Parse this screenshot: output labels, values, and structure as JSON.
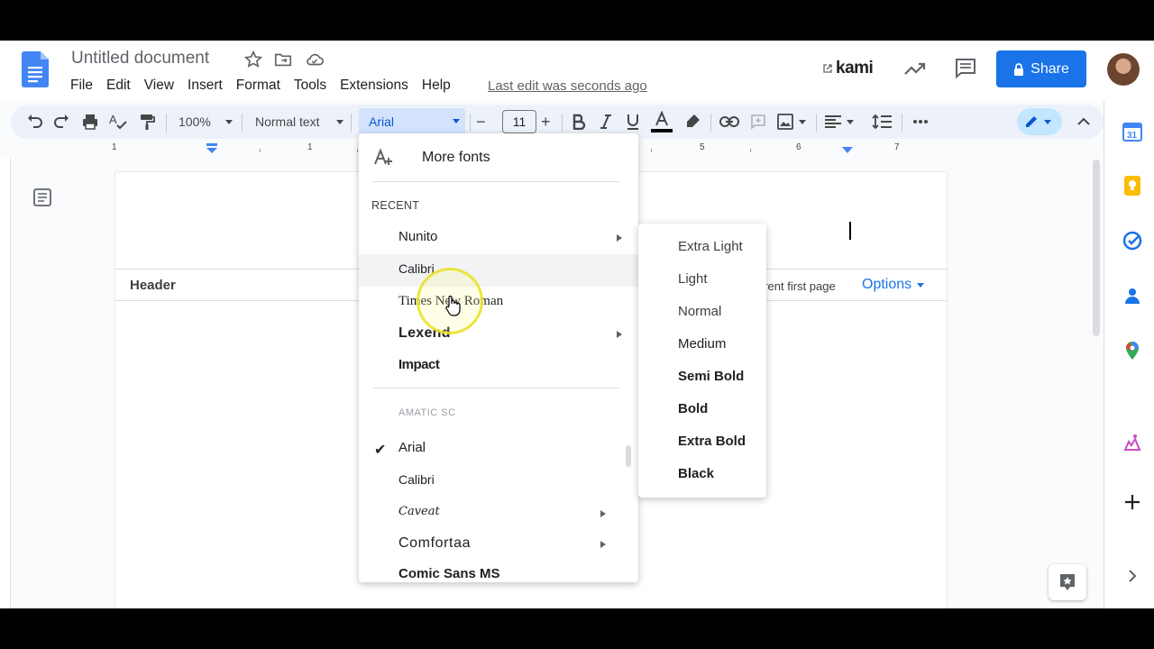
{
  "document": {
    "title": "Untitled document",
    "last_edit": "Last edit was seconds ago"
  },
  "menubar": [
    "File",
    "Edit",
    "View",
    "Insert",
    "Format",
    "Tools",
    "Extensions",
    "Help"
  ],
  "header_actions": {
    "kami_label": "kami",
    "share_label": "Share"
  },
  "toolbar": {
    "zoom": "100%",
    "style": "Normal text",
    "font": "Arial",
    "font_size": "11",
    "minus": "−",
    "plus": "+"
  },
  "ruler": {
    "numbers": [
      "1",
      "1",
      "5",
      "6",
      "7"
    ]
  },
  "page": {
    "header_label": "Header",
    "different_first_page": "erent first page",
    "options_label": "Options"
  },
  "font_menu": {
    "more_fonts": "More fonts",
    "recent_label": "RECENT",
    "recent": [
      {
        "name": "Nunito",
        "has_submenu": true
      },
      {
        "name": "Calibri",
        "has_submenu": false
      },
      {
        "name": "Times New Roman",
        "has_submenu": false
      },
      {
        "name": "Lexend",
        "has_submenu": true
      },
      {
        "name": "Impact",
        "has_submenu": false
      }
    ],
    "all": [
      {
        "name": "AMATIC SC",
        "has_submenu": false
      },
      {
        "name": "Arial",
        "has_submenu": false,
        "selected": true
      },
      {
        "name": "Calibri",
        "has_submenu": false
      },
      {
        "name": "Caveat",
        "has_submenu": true
      },
      {
        "name": "Comfortaa",
        "has_submenu": true
      },
      {
        "name": "Comic Sans MS",
        "has_submenu": false
      }
    ]
  },
  "weight_menu": [
    "Extra Light",
    "Light",
    "Normal",
    "Medium",
    "Semi Bold",
    "Bold",
    "Extra Bold",
    "Black"
  ],
  "colors": {
    "accent": "#1a73e8",
    "toolbar_bg": "#edf2fa",
    "font_box_bg": "#d3e3fd"
  }
}
